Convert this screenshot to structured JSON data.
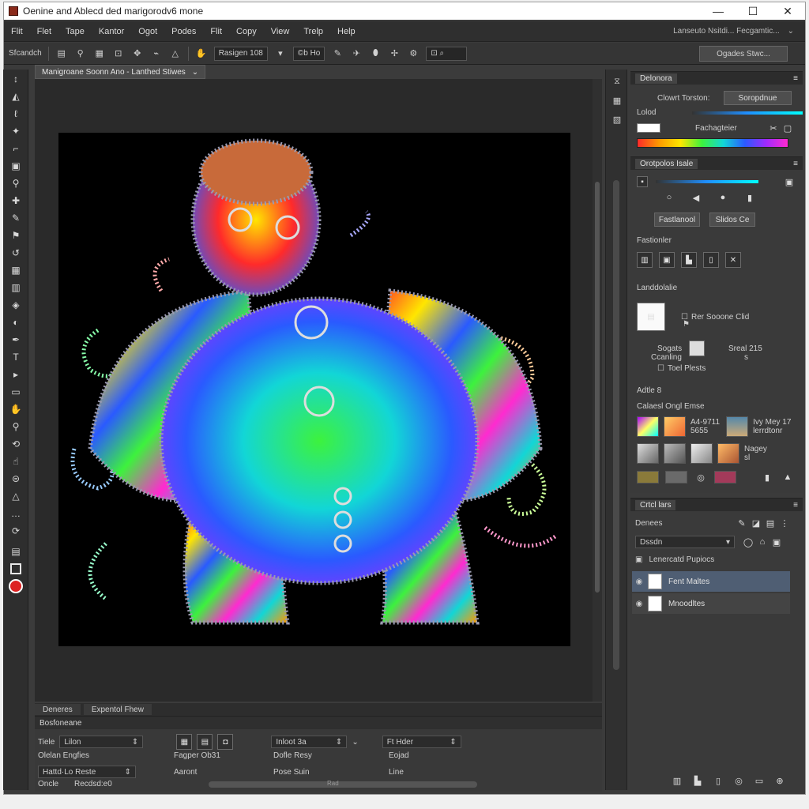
{
  "window": {
    "title": "Oenine and Ablecd ded marigorodv6 mone",
    "minimize": "—",
    "maximize": "☐",
    "close": "✕"
  },
  "menu": {
    "items": [
      "Flit",
      "Flet",
      "Tape",
      "Kantor",
      "Ogot",
      "Podes",
      "Flit",
      "Copy",
      "View",
      "Trelp",
      "Help"
    ],
    "right_text": "Lanseuto Nsitdi... Fecgamtic...",
    "right_icon": "⌄"
  },
  "options_bar": {
    "label": "Sfcandch",
    "field1": "Rasigen 108",
    "field2": "©b Ho",
    "right_field": "Ogades Stwc..."
  },
  "document": {
    "tab_label": "Manigroane Soonn Ano - Lanthed Stiwes",
    "tab_chevron": "⌄"
  },
  "bottom": {
    "tabs": [
      "Deneres",
      "Expentol Fhew"
    ],
    "panel_title": "Bosfoneane",
    "rows": {
      "r1_label": "Tiele",
      "r1_select": "Lilon",
      "r1_select2": "Inloot 3a",
      "r1_select3": "Ft Hder",
      "r2_a": "Olelan Engfies",
      "r2_b": "Fagper Ob31",
      "r2_c": "Dofle Resy",
      "r2_d": "Eojad",
      "r3_a": "Hattd·Lo Reste",
      "r3_b": "Aaront",
      "r3_c": "Pose Suin",
      "r3_d": "Line",
      "r4_a": "Oncle",
      "r4_b": "Recdsd:e0",
      "r4_scroll": "Rad"
    }
  },
  "right": {
    "panel1": {
      "title": "Delonora",
      "label1": "Clowrt Torston:",
      "btn1": "Soropdnue",
      "label2": "Lolod",
      "label3": "Fachagteier"
    },
    "panel2": {
      "title": "Orotpolos Isale",
      "btn1": "Fastlanool",
      "btn2": "Slidos Ce",
      "section1": "Fastionler",
      "section2": "Landdolalie",
      "check1": "Rer Sooone Clid",
      "lbl_a": "Sogats",
      "lbl_b": "Ccanling",
      "lbl_c": "Sreal 215",
      "lbl_d": "s",
      "check2": "Toel Plests",
      "section3": "Adtle 8",
      "section4": "Calaesl Ongl Emse",
      "item1a": "A4-9711",
      "item1b": "5655",
      "item2a": "Ivy Mey 17",
      "item2b": "lerrdtonr",
      "item3": "Nagey",
      "item3b": "sl"
    },
    "panel3": {
      "title": "Crtcl lars",
      "label": "Denees",
      "select": "Dssdn",
      "layers_header": "Lenercatd Pupiocs",
      "layers": [
        "Fent Maltes",
        "Mnoodltes"
      ]
    }
  },
  "colors": {
    "bg": "#3b3b3b",
    "panel": "#3a3a3a",
    "canvas": "#000000",
    "selected_layer": "#4f5e73"
  }
}
